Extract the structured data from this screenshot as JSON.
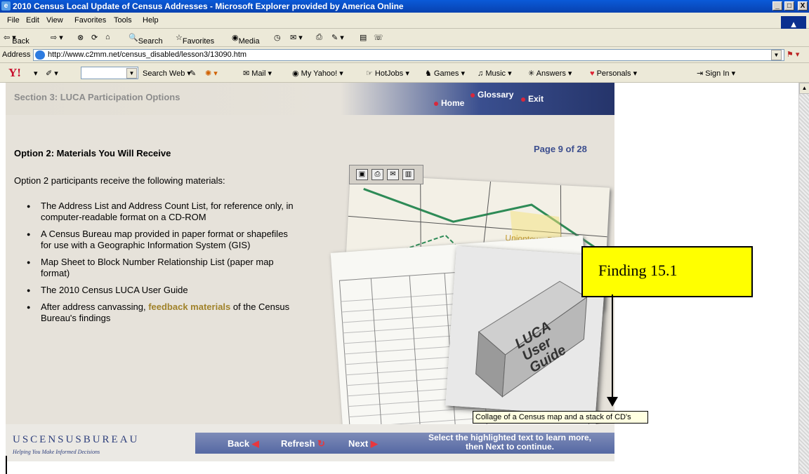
{
  "window": {
    "title": "2010 Census Local Update of Census Addresses - Microsoft Explorer provided by America Online",
    "controls": {
      "minimize": "_",
      "maximize": "□",
      "close": "X"
    }
  },
  "menu": [
    "File",
    "Edit",
    "View",
    "Favorites",
    "Tools",
    "Help"
  ],
  "toolbar": {
    "back": "Back",
    "search": "Search",
    "favorites": "Favorites",
    "media": "Media"
  },
  "address": {
    "label": "Address",
    "url": "http://www.c2mm.net/census_disabled/lesson3/13090.htm"
  },
  "yahoo_bar": {
    "search_web": "Search Web",
    "items": [
      "Mail",
      "My Yahoo!",
      "HotJobs",
      "Games",
      "Music",
      "Answers",
      "Personals",
      "Sign In"
    ]
  },
  "lesson": {
    "section": "Section 3: LUCA Participation Options",
    "nav": {
      "home": "Home",
      "glossary": "Glossary",
      "exit": "Exit"
    },
    "option_title": "Option 2: Materials You Will Receive",
    "page": "Page 9 of 28",
    "intro": "Option 2 participants receive the following materials:",
    "bullets": [
      "The Address List and Address Count List, for reference only, in computer-readable format on a CD-ROM",
      "A Census Bureau map provided in paper format or shapefiles for use with a Geographic Information System (GIS)",
      "Map Sheet to Block Number Relationship List (paper map format)",
      "The 2010 Census LUCA User Guide"
    ],
    "last_bullet": {
      "before": "After address canvassing, ",
      "link": "feedback materials",
      "after": " of the Census Bureau's findings"
    },
    "map_label": "Uniontown 78528",
    "binder_label": "LUCA User Guide",
    "footer": {
      "logo": "USCENSUSBUREAU",
      "tagline": "Helping You Make Informed Decisions",
      "back": "Back",
      "refresh": "Refresh",
      "next": "Next",
      "instruction": "Select the highlighted text to learn more, then Next to continue."
    }
  },
  "tooltip": "Collage of a Census map and a stack of CD's",
  "annotation": "Finding 15.1"
}
